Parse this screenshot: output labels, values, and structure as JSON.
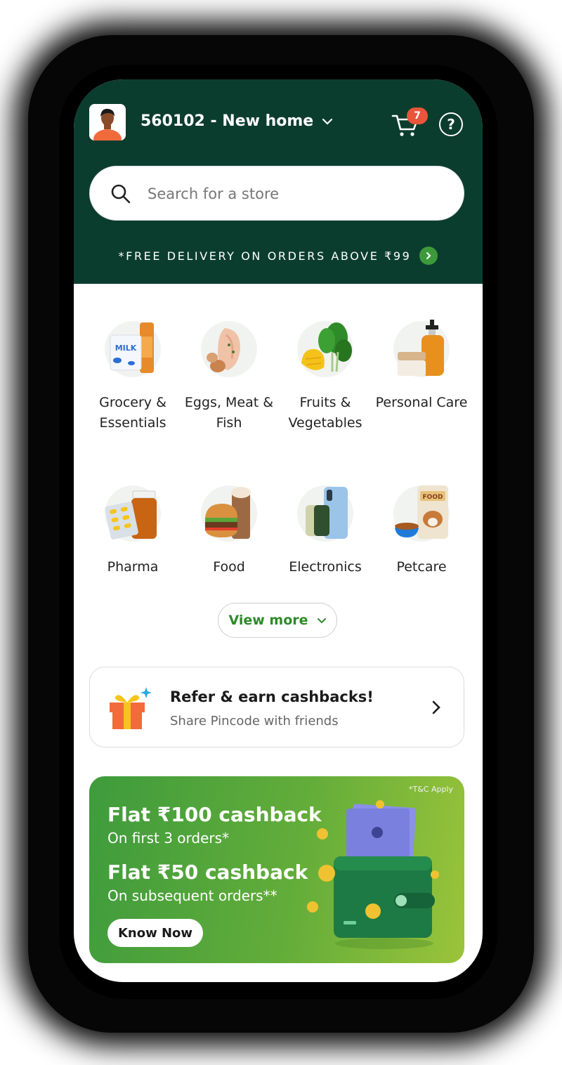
{
  "header": {
    "location": "560102 - New home",
    "cart_count": "7",
    "help_symbol": "?",
    "bg_color": "#0b3d2e"
  },
  "search": {
    "placeholder": "Search for a store"
  },
  "promo": {
    "text": "*FREE DELIVERY ON ORDERS ABOVE ₹99"
  },
  "categories": [
    {
      "label": "Grocery & Essentials",
      "icon": "grocery-icon"
    },
    {
      "label": "Eggs, Meat & Fish",
      "icon": "meat-icon"
    },
    {
      "label": "Fruits & Vegetables",
      "icon": "vegetables-icon"
    },
    {
      "label": "Personal Care",
      "icon": "personal-care-icon"
    },
    {
      "label": "Pharma",
      "icon": "pharma-icon"
    },
    {
      "label": "Food",
      "icon": "food-icon"
    },
    {
      "label": "Electronics",
      "icon": "electronics-icon"
    },
    {
      "label": "Petcare",
      "icon": "petcare-icon"
    }
  ],
  "view_more": {
    "label": "View more"
  },
  "refer": {
    "title": "Refer & earn cashbacks!",
    "subtitle": "Share Pincode with friends"
  },
  "banner": {
    "tc": "*T&C Apply",
    "line1": "Flat ₹100 cashback",
    "line2": "On first 3 orders*",
    "line3": "Flat ₹50 cashback",
    "line4": "On subsequent orders**",
    "cta": "Know Now",
    "colors": {
      "start": "#3e9b3c",
      "end": "#9bc43a"
    }
  },
  "accent_green": "#2e8b2a"
}
